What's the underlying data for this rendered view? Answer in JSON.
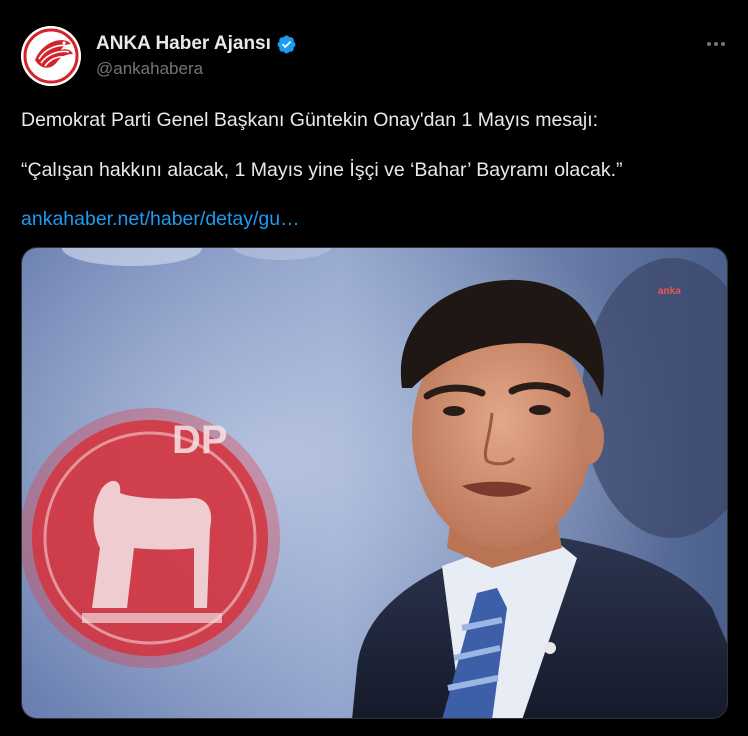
{
  "author": {
    "display_name": "ANKA Haber Ajansı",
    "handle": "@ankahabera",
    "verified": true,
    "avatar_icon": "anka-logo-icon"
  },
  "tweet": {
    "line1": "Demokrat Parti Genel Başkanı Güntekin Onay'dan 1 Mayıs mesajı:",
    "line2": "“Çalışan hakkını alacak, 1 Mayıs yine İşçi ve ‘Bahar’ Bayramı olacak.”",
    "link_text": "ankahaber.net/haber/detay/gu…"
  },
  "media": {
    "watermark": "anka",
    "logo_text": "DP"
  },
  "colors": {
    "background": "#000000",
    "text": "#e7e9ea",
    "secondary": "#71767b",
    "link": "#1d9bf0",
    "verified": "#1d9bf0",
    "brand_red": "#d4242b"
  },
  "icons": {
    "more": "more-horizontal-icon",
    "verified": "verified-badge-icon"
  }
}
